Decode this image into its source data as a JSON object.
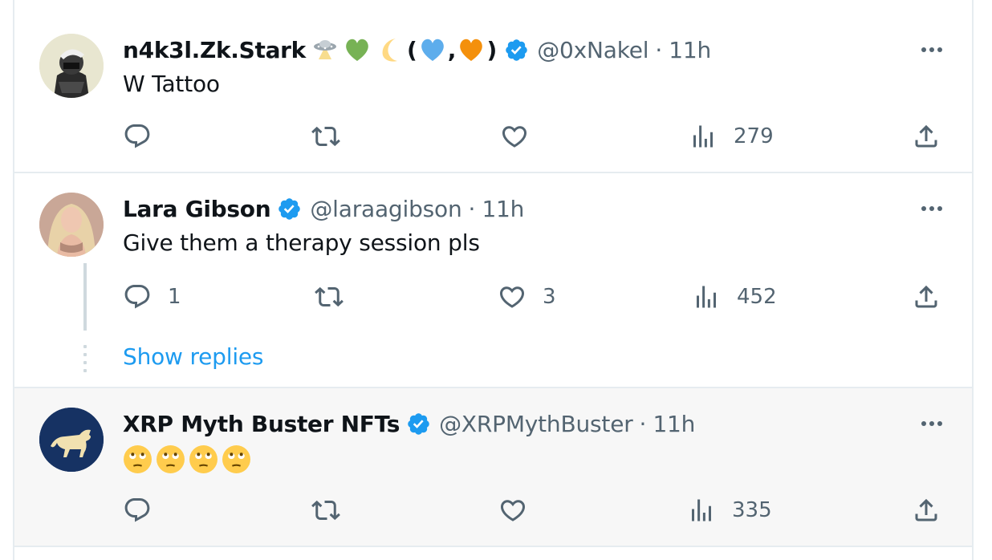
{
  "tweets": [
    {
      "name": "n4k3l.Zk.Stark",
      "name_emojis": [
        "flying-saucer-icon",
        "green-heart-icon",
        "crescent-moon-icon"
      ],
      "paren_open": "(",
      "comma": ",",
      "paren_close": ")",
      "paren_emojis": [
        "blue-heart-icon",
        "orange-heart-icon"
      ],
      "handle": "@0xNakel",
      "separator": "·",
      "time": "11h",
      "text": "W Tattoo",
      "replies": "",
      "retweets": "",
      "likes": "",
      "views": "279"
    },
    {
      "name": "Lara Gibson",
      "handle": "@laraagibson",
      "separator": "·",
      "time": "11h",
      "text": "Give them a therapy session pls",
      "replies": "1",
      "retweets": "",
      "likes": "3",
      "views": "452",
      "show_replies": "Show replies"
    },
    {
      "name": "XRP Myth Buster NFTs",
      "handle": "@XRPMythBuster",
      "separator": "·",
      "time": "11h",
      "text_emojis": [
        "eye-roll-face-icon",
        "eye-roll-face-icon",
        "eye-roll-face-icon",
        "eye-roll-face-icon"
      ],
      "replies": "",
      "retweets": "",
      "likes": "",
      "views": "335"
    }
  ],
  "colors": {
    "verified": "#1d9bf0",
    "link": "#1d9bf0",
    "secondary_text": "#536471",
    "divider": "#e6ecf0",
    "highlight_bg": "#f7f7f7"
  }
}
